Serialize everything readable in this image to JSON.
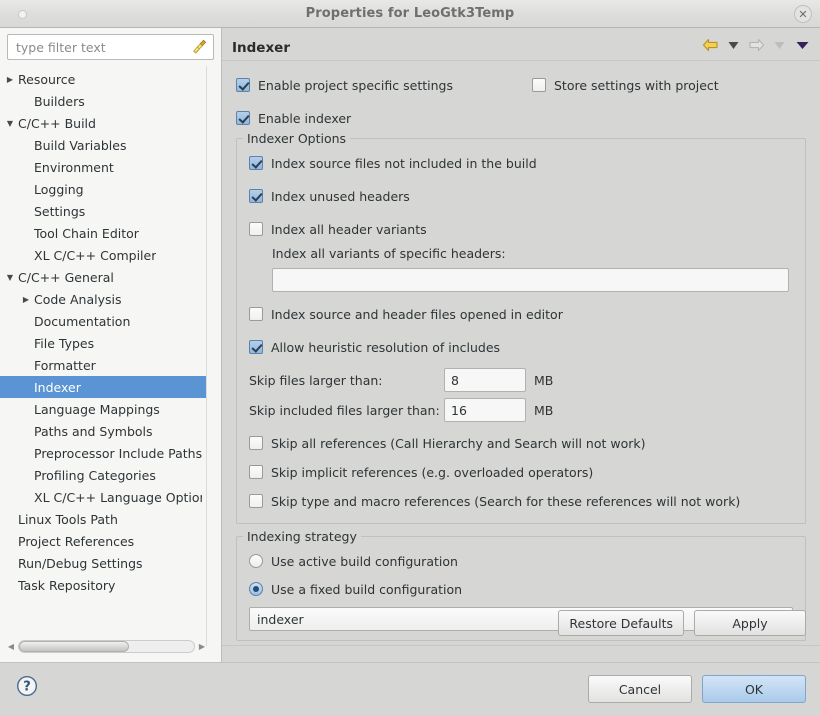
{
  "window": {
    "title": "Properties for LeoGtk3Temp",
    "close_icon": "close-icon",
    "menu_dot_icon": "window-menu-icon"
  },
  "sidebar": {
    "filter": {
      "placeholder": "type filter text",
      "value": "",
      "clear_icon": "broom-clear-icon"
    },
    "items": [
      {
        "label": "Resource",
        "level": 0,
        "arrow": "▶",
        "selected": false
      },
      {
        "label": "Builders",
        "level": 1,
        "arrow": "",
        "selected": false
      },
      {
        "label": "C/C++ Build",
        "level": 0,
        "arrow": "▼",
        "selected": false
      },
      {
        "label": "Build Variables",
        "level": 1,
        "arrow": "",
        "selected": false
      },
      {
        "label": "Environment",
        "level": 1,
        "arrow": "",
        "selected": false
      },
      {
        "label": "Logging",
        "level": 1,
        "arrow": "",
        "selected": false
      },
      {
        "label": "Settings",
        "level": 1,
        "arrow": "",
        "selected": false
      },
      {
        "label": "Tool Chain Editor",
        "level": 1,
        "arrow": "",
        "selected": false
      },
      {
        "label": "XL C/C++ Compiler",
        "level": 1,
        "arrow": "",
        "selected": false
      },
      {
        "label": "C/C++ General",
        "level": 0,
        "arrow": "▼",
        "selected": false
      },
      {
        "label": "Code Analysis",
        "level": 1,
        "arrow": "▶",
        "selected": false
      },
      {
        "label": "Documentation",
        "level": 1,
        "arrow": "",
        "selected": false
      },
      {
        "label": "File Types",
        "level": 1,
        "arrow": "",
        "selected": false
      },
      {
        "label": "Formatter",
        "level": 1,
        "arrow": "",
        "selected": false
      },
      {
        "label": "Indexer",
        "level": 1,
        "arrow": "",
        "selected": true
      },
      {
        "label": "Language Mappings",
        "level": 1,
        "arrow": "",
        "selected": false
      },
      {
        "label": "Paths and Symbols",
        "level": 1,
        "arrow": "",
        "selected": false
      },
      {
        "label": "Preprocessor Include Paths,",
        "level": 1,
        "arrow": "",
        "selected": false
      },
      {
        "label": "Profiling Categories",
        "level": 1,
        "arrow": "",
        "selected": false
      },
      {
        "label": "XL C/C++ Language Option",
        "level": 1,
        "arrow": "",
        "selected": false
      },
      {
        "label": "Linux Tools Path",
        "level": 0,
        "arrow": "",
        "selected": false
      },
      {
        "label": "Project References",
        "level": 0,
        "arrow": "",
        "selected": false
      },
      {
        "label": "Run/Debug Settings",
        "level": 0,
        "arrow": "",
        "selected": false
      },
      {
        "label": "Task Repository",
        "level": 0,
        "arrow": "",
        "selected": false
      }
    ]
  },
  "page": {
    "title": "Indexer",
    "nav": {
      "back_icon": "back-arrow-icon",
      "back_menu_icon": "back-dropdown-icon",
      "forward_icon": "forward-arrow-icon",
      "forward_menu_icon": "forward-dropdown-icon",
      "view_menu_icon": "view-menu-icon"
    }
  },
  "main": {
    "enable_project_specific": {
      "label": "Enable project specific settings",
      "checked": true
    },
    "store_settings_with_project": {
      "label": "Store settings with project",
      "checked": false
    },
    "enable_indexer": {
      "label": "Enable indexer",
      "checked": true
    },
    "indexer_options": {
      "title": "Indexer Options",
      "checkboxes_top": [
        {
          "label": "Index source files not included in the build",
          "checked": true
        },
        {
          "label": "Index unused headers",
          "checked": true
        },
        {
          "label": "Index all header variants",
          "checked": false
        }
      ],
      "specific_headers_label": "Index all variants of specific headers:",
      "specific_headers_value": "",
      "checkboxes_mid": [
        {
          "label": "Index source and header files opened in editor",
          "checked": false
        },
        {
          "label": "Allow heuristic resolution of includes",
          "checked": true
        }
      ],
      "skip_files_label": "Skip files larger than:",
      "skip_files_value": "8",
      "skip_files_unit": "MB",
      "skip_included_label": "Skip included files larger than:",
      "skip_included_value": "16",
      "skip_included_unit": "MB",
      "checkboxes_bottom": [
        {
          "label": "Skip all references (Call Hierarchy and Search will not work)",
          "checked": false
        },
        {
          "label": "Skip implicit references (e.g. overloaded operators)",
          "checked": false
        },
        {
          "label": "Skip type and macro references (Search for these references will not work)",
          "checked": false
        }
      ]
    },
    "indexing_strategy": {
      "title": "Indexing strategy",
      "radios": [
        {
          "label": "Use active build configuration",
          "checked": false
        },
        {
          "label": "Use a fixed build configuration",
          "checked": true
        }
      ],
      "config_value": "indexer"
    },
    "restore_defaults_label": "Restore Defaults",
    "apply_label": "Apply"
  },
  "footer": {
    "help_icon": "help-icon",
    "cancel_label": "Cancel",
    "ok_label": "OK"
  },
  "colors": {
    "selection": "#5a94d4",
    "checkbox_checked": "#8fb7de",
    "ok_button": "#a9cbea",
    "back_arrow": "#e5b820"
  }
}
